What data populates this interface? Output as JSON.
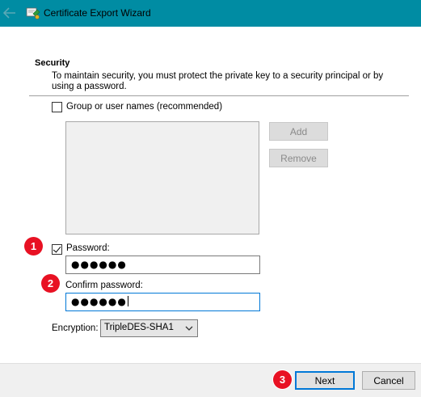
{
  "window": {
    "title": "Certificate Export Wizard"
  },
  "security": {
    "heading": "Security",
    "description": "To maintain security, you must protect the private key to a security principal or by using a password.",
    "group_checkbox_label": "Group or user names (recommended)",
    "group_checked": false,
    "add_label": "Add",
    "remove_label": "Remove",
    "password_checkbox_label": "Password:",
    "password_checked": true,
    "password_value": "●●●●●●",
    "confirm_label": "Confirm password:",
    "confirm_value": "●●●●●●",
    "encryption_label": "Encryption:",
    "encryption_value": "TripleDES-SHA1"
  },
  "footer": {
    "next_label": "Next",
    "cancel_label": "Cancel"
  },
  "markers": [
    "1",
    "2",
    "3"
  ],
  "colors": {
    "titlebar": "#008ca3",
    "marker": "#e81123",
    "focus": "#0078d7"
  }
}
